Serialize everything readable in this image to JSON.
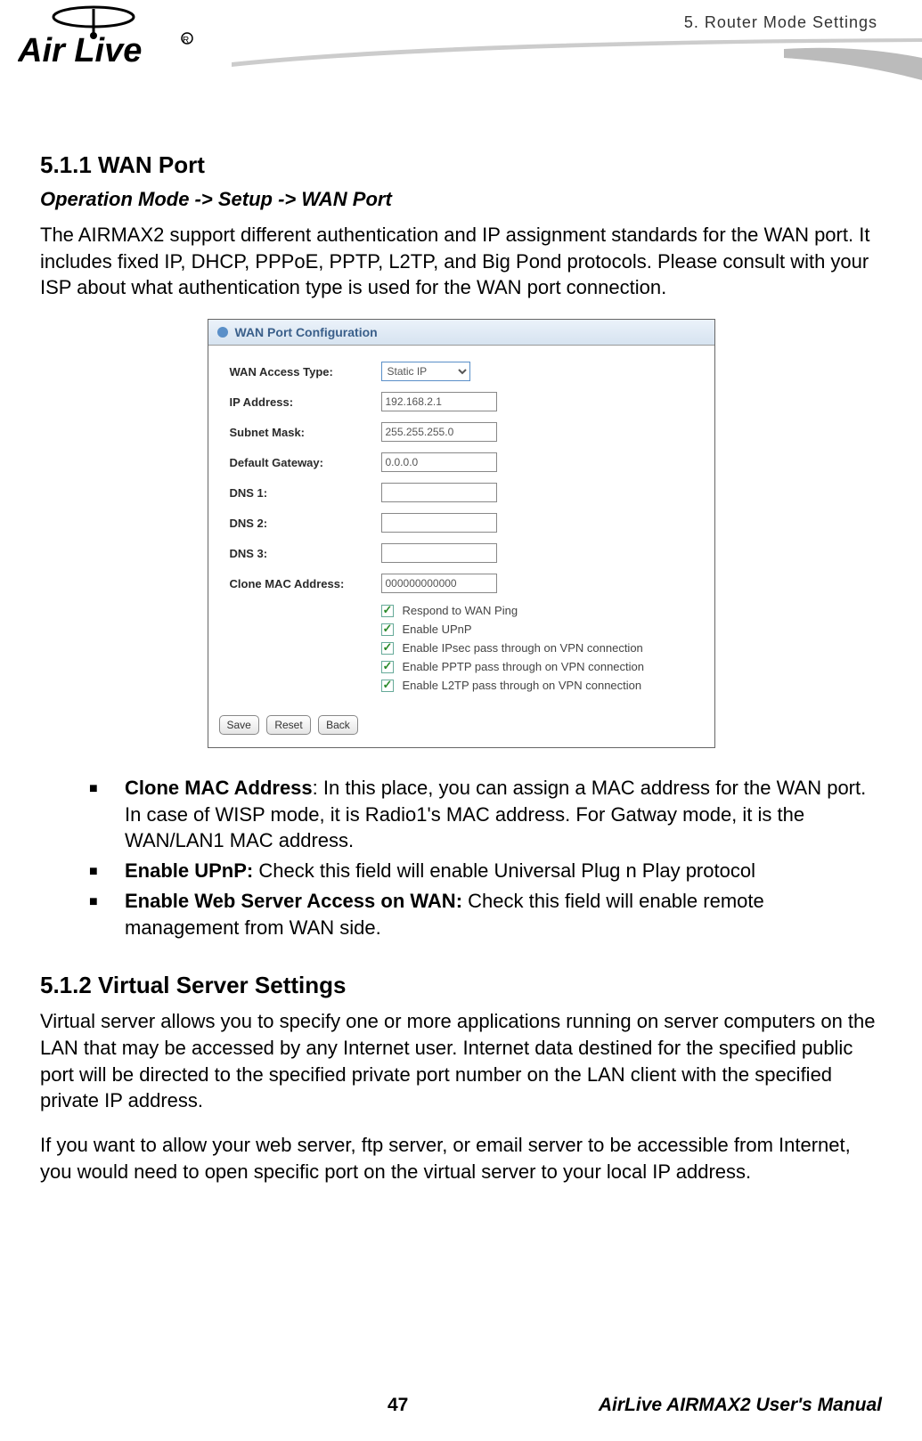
{
  "header": {
    "chapter": "5.  Router Mode Settings",
    "logo_alt": "Air Live"
  },
  "section1": {
    "title": "5.1.1 WAN Port",
    "breadcrumb": "Operation Mode -> Setup -> WAN Port",
    "intro": "The AIRMAX2 support different authentication and IP assignment standards for the WAN port.   It includes fixed IP, DHCP, PPPoE, PPTP, L2TP, and Big Pond protocols.   Please consult with your ISP about what authentication type is used for the WAN port connection."
  },
  "config": {
    "panel_title": "WAN Port Configuration",
    "fields": {
      "wan_access_type": {
        "label": "WAN Access Type:",
        "value": "Static IP"
      },
      "ip_address": {
        "label": "IP Address:",
        "value": "192.168.2.1"
      },
      "subnet_mask": {
        "label": "Subnet Mask:",
        "value": "255.255.255.0"
      },
      "default_gateway": {
        "label": "Default Gateway:",
        "value": "0.0.0.0"
      },
      "dns1": {
        "label": "DNS 1:",
        "value": ""
      },
      "dns2": {
        "label": "DNS 2:",
        "value": ""
      },
      "dns3": {
        "label": "DNS 3:",
        "value": ""
      },
      "clone_mac": {
        "label": "Clone MAC Address:",
        "value": "000000000000"
      }
    },
    "checkboxes": {
      "respond_ping": "Respond to WAN Ping",
      "enable_upnp": "Enable UPnP",
      "ipsec": "Enable IPsec pass through on VPN connection",
      "pptp": "Enable PPTP pass through on VPN connection",
      "l2tp": "Enable L2TP pass through on VPN connection"
    },
    "buttons": {
      "save": "Save",
      "reset": "Reset",
      "back": "Back"
    }
  },
  "bullets": {
    "item1_title": "Clone MAC Address",
    "item1_text": ":   In this place, you can assign a MAC address for the WAN port.   In case of WISP mode, it is Radio1's MAC address.   For Gatway mode, it is the WAN/LAN1 MAC address.",
    "item2_title": "Enable UPnP:",
    "item2_text": "   Check this field will enable Universal Plug n Play protocol",
    "item3_title": "Enable Web Server Access on WAN:",
    "item3_text": " Check this field will enable remote management from WAN side."
  },
  "section2": {
    "title": "5.1.2 Virtual Server Settings",
    "para1": "Virtual server allows you to specify one or more applications running on server computers on the LAN that may be accessed by any Internet user. Internet data destined for the specified public port will be directed to the specified private port number on the LAN client with the specified private IP address.",
    "para2": "If you want to allow your web server, ftp server, or email server to be accessible from Internet, you would need to open specific port on the virtual server to your local IP address."
  },
  "footer": {
    "page": "47",
    "manual": "AirLive AIRMAX2 User's Manual"
  }
}
